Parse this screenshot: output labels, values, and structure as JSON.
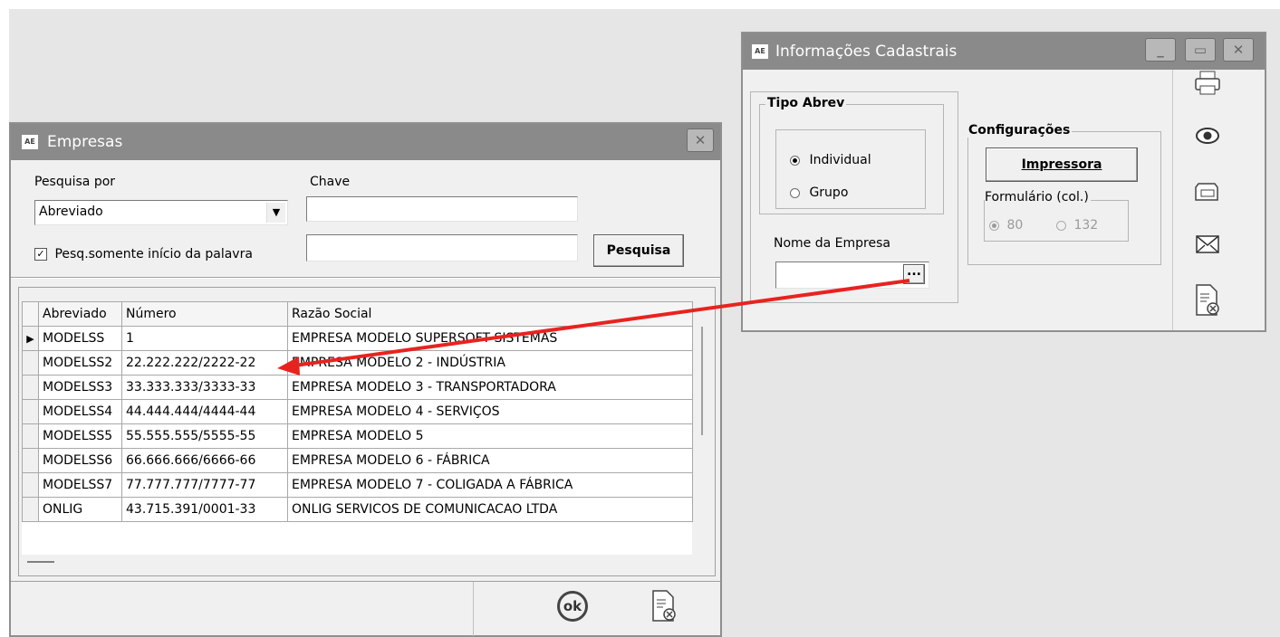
{
  "empresas": {
    "title": "Empresas",
    "icon_text": "AE",
    "search_by_label": "Pesquisa por",
    "search_by_value": "Abreviado",
    "key_label": "Chave",
    "key_value": "",
    "second_search_value": "",
    "only_start_checkbox_label": "Pesq.somente início da palavra",
    "only_start_checked": true,
    "search_button": "Pesquisa",
    "columns": [
      "Abreviado",
      "Número",
      "Razão Social"
    ],
    "rows": [
      {
        "abreviado": "MODELSS",
        "numero": "1",
        "razao": "EMPRESA MODELO SUPERSOFT SISTEMAS"
      },
      {
        "abreviado": "MODELSS2",
        "numero": "22.222.222/2222-22",
        "razao": "EMPRESA MODELO 2 - INDÚSTRIA"
      },
      {
        "abreviado": "MODELSS3",
        "numero": "33.333.333/3333-33",
        "razao": "EMPRESA MODELO 3 - TRANSPORTADORA"
      },
      {
        "abreviado": "MODELSS4",
        "numero": "44.444.444/4444-44",
        "razao": "EMPRESA MODELO 4 - SERVIÇOS"
      },
      {
        "abreviado": "MODELSS5",
        "numero": "55.555.555/5555-55",
        "razao": "EMPRESA MODELO 5"
      },
      {
        "abreviado": "MODELSS6",
        "numero": "66.666.666/6666-66",
        "razao": "EMPRESA MODELO 6 - FÁBRICA"
      },
      {
        "abreviado": "MODELSS7",
        "numero": "77.777.777/7777-77",
        "razao": "EMPRESA MODELO 7 - COLIGADA A FÁBRICA"
      },
      {
        "abreviado": "ONLIG",
        "numero": "43.715.391/0001-33",
        "razao": "ONLIG SERVICOS DE COMUNICACAO LTDA"
      }
    ],
    "selected_row": 0,
    "ok_label": "ok"
  },
  "info": {
    "title": "Informações Cadastrais",
    "icon_text": "AE",
    "tipo_abrev_label": "Tipo Abrev",
    "radio_individual": "Individual",
    "radio_grupo": "Grupo",
    "nome_empresa_label": "Nome da Empresa",
    "nome_empresa_value": "",
    "browse_button": "...",
    "configuracoes_label": "Configurações",
    "impressora_button": "Impressora",
    "formulario_label": "Formulário (col.)",
    "col_80": "80",
    "col_132": "132"
  },
  "annotation_color": "#e8231f"
}
